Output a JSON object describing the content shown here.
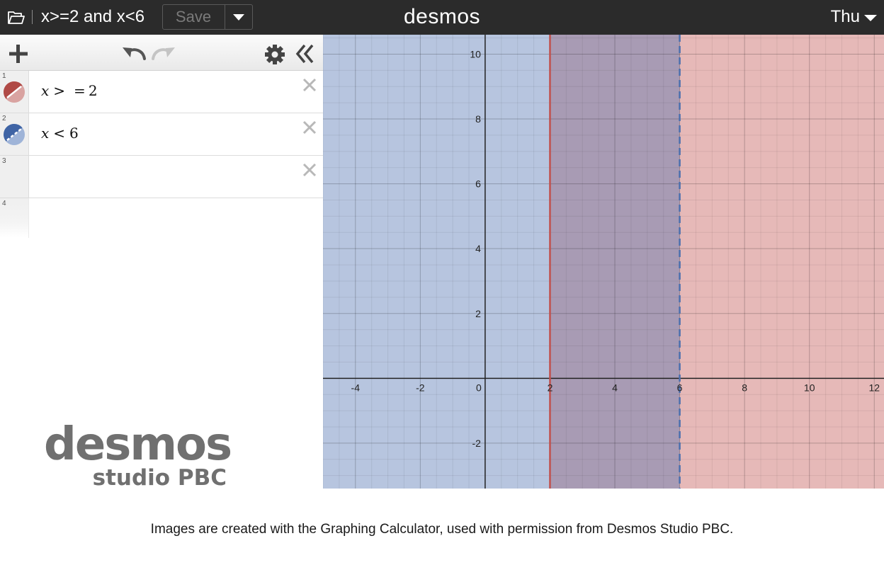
{
  "header": {
    "graph_title": "x>=2 and x<6",
    "save_label": "Save",
    "brand": "desmos",
    "user_menu_label": "Thu",
    "icons": [
      "folder-icon",
      "caret-down-icon"
    ]
  },
  "toolbar": {
    "icons": [
      "plus-icon",
      "undo-icon",
      "redo-icon",
      "gear-icon",
      "collapse-icon"
    ]
  },
  "expressions": [
    {
      "index": "1",
      "latex_parts": [
        "x",
        ">",
        "=",
        "2"
      ],
      "color": "#c0504d"
    },
    {
      "index": "2",
      "latex_parts": [
        "x",
        "<",
        "6"
      ],
      "color": "#4a6fae"
    },
    {
      "index": "3",
      "latex_parts": [],
      "color": ""
    },
    {
      "index": "4",
      "latex_parts": [],
      "color": ""
    }
  ],
  "watermark": {
    "line1": "desmos",
    "line2": "studio PBC"
  },
  "caption": "Images are created with the Graphing Calculator, used with permission from Desmos Studio PBC.",
  "graph": {
    "x_range": [
      -5,
      12.3
    ],
    "y_range": [
      -3.4,
      10.6
    ],
    "x_tick_labels": [
      "-4",
      "-2",
      "0",
      "2",
      "4",
      "6",
      "8",
      "10",
      "12"
    ],
    "y_tick_labels": [
      "10",
      "8",
      "6",
      "4",
      "2",
      "-2"
    ],
    "regions": [
      {
        "inequality": "x >= 2",
        "boundary": 2,
        "side": "right",
        "boundary_style": "solid",
        "color": "#c0504d"
      },
      {
        "inequality": "x < 6",
        "boundary": 6,
        "side": "left",
        "boundary_style": "dashed",
        "color": "#4a6fae"
      }
    ]
  }
}
